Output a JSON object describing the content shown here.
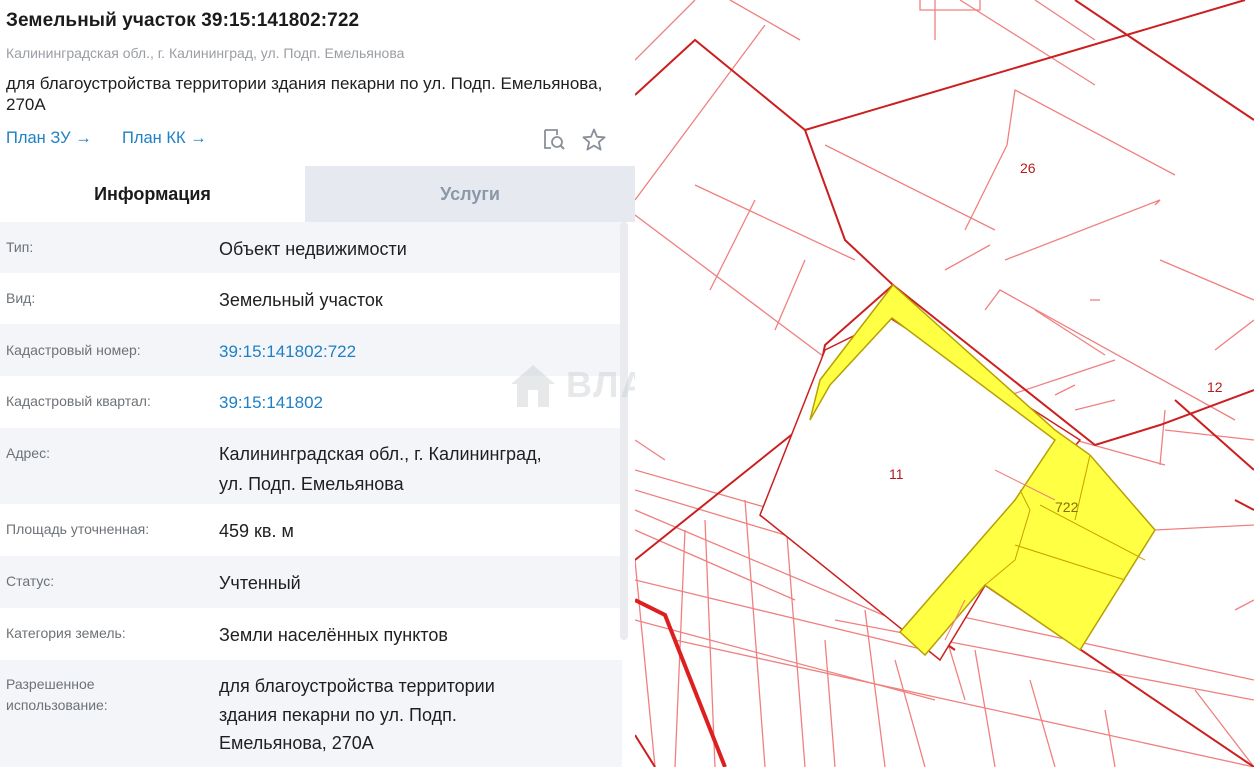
{
  "parcel": {
    "title": "Земельный участок 39:15:141802:722",
    "address": "Калининградская обл., г. Калининград, ул. Подп. Емельянова",
    "purpose": "для благоустройства территории здания пекарни по ул. Подп. Емельянова, 270А"
  },
  "links": {
    "plan_zu": "План ЗУ →",
    "plan_kk": "План КК →"
  },
  "icons": {
    "search_document": "search-document-icon",
    "favorite": "star-icon"
  },
  "tabs": [
    {
      "label": "Информация",
      "active": true
    },
    {
      "label": "Услуги",
      "active": false
    }
  ],
  "info_rows": [
    {
      "label": "Тип:",
      "value": "Объект недвижимости"
    },
    {
      "label": "Вид:",
      "value": "Земельный участок"
    },
    {
      "label": "Кадастровый номер:",
      "value": "39:15:141802:722"
    },
    {
      "label": "Кадастровый квартал:",
      "value": "39:15:141802"
    },
    {
      "label": "Адрес:",
      "value_lines": [
        "Калининградская обл., г. Калининград,",
        "ул. Подп. Емельянова"
      ]
    },
    {
      "label": "Площадь уточненная:",
      "value": "459 кв. м"
    },
    {
      "label": "Статус:",
      "value": "Учтенный"
    },
    {
      "label": "Категория земель:",
      "value": "Земли населённых пунктов"
    },
    {
      "label_lines": [
        "Разрешенное",
        "использование:"
      ],
      "value_lines": [
        "для благоустройства территории",
        "здания пекарни по ул. Подп.",
        "Емельянова, 270А"
      ]
    }
  ],
  "watermark": "ВЛАДИС",
  "map": {
    "labels": [
      "26",
      "12",
      "11",
      "722"
    ],
    "colors": {
      "boundary_dark": "#cc1f1f",
      "boundary_light": "#f08080",
      "selected_fill": "#ffff44",
      "selected_stroke": "#b8a000",
      "label_dark": "#b51c1c",
      "label_selected": "#8a6d00"
    }
  },
  "colors": {
    "link": "#1f80c6",
    "tab_inactive_bg": "#e6eaf0",
    "row_alt_bg": "#f3f5f8"
  }
}
